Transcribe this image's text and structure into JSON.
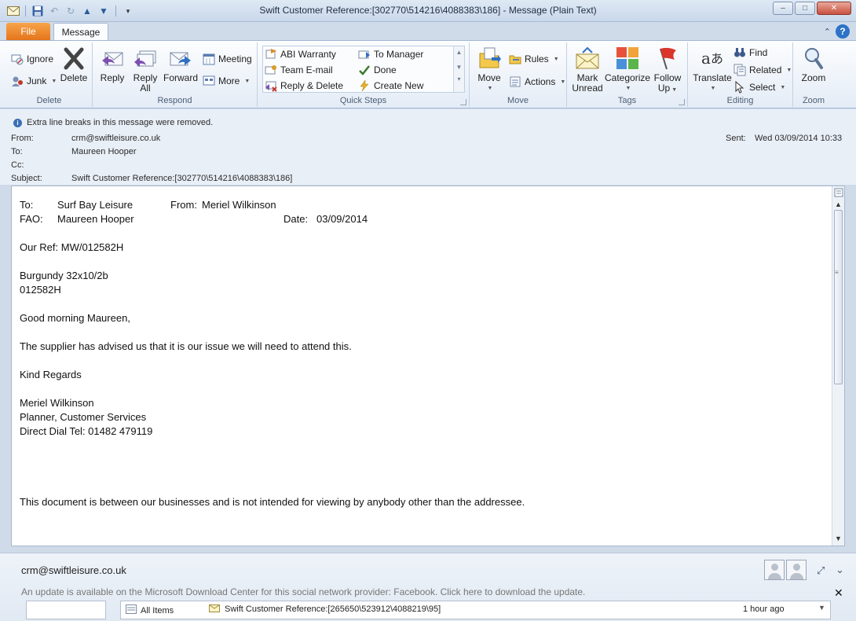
{
  "window": {
    "title": "Swift Customer Reference:[302770\\514216\\4088383\\186]  -  Message (Plain Text)",
    "controls": {
      "minimize": "–",
      "maximize": "□",
      "close": "✕"
    }
  },
  "ribbon_tabs": {
    "file": "File",
    "message": "Message"
  },
  "ribbon": {
    "delete_group": {
      "label": "Delete",
      "ignore": "Ignore",
      "junk": "Junk",
      "delete": "Delete"
    },
    "respond_group": {
      "label": "Respond",
      "reply": "Reply",
      "reply_all_1": "Reply",
      "reply_all_2": "All",
      "forward": "Forward",
      "meeting": "Meeting",
      "more": "More"
    },
    "quick_steps_group": {
      "label": "Quick Steps",
      "abi_warranty": "ABI Warranty",
      "team_email": "Team E-mail",
      "reply_delete": "Reply & Delete",
      "to_manager": "To Manager",
      "done": "Done",
      "create_new": "Create New"
    },
    "move_group": {
      "label": "Move",
      "move": "Move",
      "rules": "Rules",
      "actions": "Actions"
    },
    "tags_group": {
      "label": "Tags",
      "mark_unread_1": "Mark",
      "mark_unread_2": "Unread",
      "categorize": "Categorize",
      "follow_up_1": "Follow",
      "follow_up_2": "Up"
    },
    "editing_group": {
      "label": "Editing",
      "translate": "Translate",
      "find": "Find",
      "related": "Related",
      "select": "Select"
    },
    "zoom_group": {
      "label": "Zoom",
      "zoom": "Zoom"
    }
  },
  "info": {
    "notice": "Extra line breaks in this message were removed.",
    "from_label": "From:",
    "from_value": "crm@swiftleisure.co.uk",
    "to_label": "To:",
    "to_value": "Maureen Hooper",
    "cc_label": "Cc:",
    "cc_value": "",
    "subject_label": "Subject:",
    "subject_value": "Swift Customer Reference:[302770\\514216\\4088383\\186]",
    "sent_label": "Sent:",
    "sent_value": "Wed 03/09/2014 10:33"
  },
  "message": {
    "to_label": "To:",
    "to_value": "Surf Bay Leisure",
    "from_label": "From:",
    "from_value": "Meriel Wilkinson",
    "fao_label": "FAO:",
    "fao_value": "Maureen Hooper",
    "date_label": "Date:",
    "date_value": "03/09/2014",
    "our_ref": "Our Ref: MW/012582H",
    "product": "Burgundy 32x10/2b",
    "product_code": "012582H",
    "greeting": "Good morning Maureen,",
    "body": "The supplier has advised us that it is our issue we will need to attend this.",
    "signoff": "Kind Regards",
    "sig_name": "Meriel Wilkinson",
    "sig_title": "Planner, Customer Services",
    "sig_phone": "Direct Dial Tel: 01482 479119",
    "disclaimer": "This document is between our businesses and is not intended for viewing by anybody other than the addressee."
  },
  "people_pane": {
    "name": "crm@swiftleisure.co.uk",
    "update_notice": "An update is available on the Microsoft Download Center for this social network provider: Facebook. Click here to download the update.",
    "filter": "All Items",
    "feed_item": "Swift Customer Reference:[265650\\523912\\4088219\\95]",
    "feed_time": "1 hour ago"
  }
}
